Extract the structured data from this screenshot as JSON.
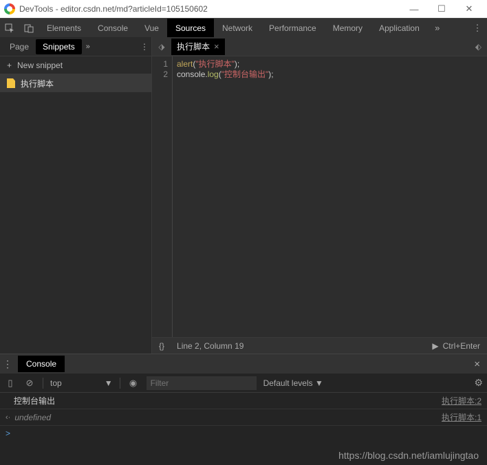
{
  "titlebar": {
    "text": "DevTools - editor.csdn.net/md?articleId=105150602"
  },
  "toolbar": {
    "tabs": [
      "Elements",
      "Console",
      "Vue",
      "Sources",
      "Network",
      "Performance",
      "Memory",
      "Application"
    ],
    "active_index": 3
  },
  "left": {
    "tabs": {
      "page": "Page",
      "snippets": "Snippets"
    },
    "new_snippet": "New snippet",
    "snippet_name": "执行脚本"
  },
  "editor": {
    "tab_name": "执行脚本",
    "lines": [
      {
        "n": "1",
        "fn": "alert",
        "str": "\"执行脚本\"",
        "tail": ");"
      },
      {
        "n": "2",
        "pre": "console.",
        "call": "log",
        "str": "\"控制台输出\"",
        "tail": ");"
      }
    ],
    "status_braces": "{}",
    "status_pos": "Line 2, Column 19",
    "run_label": "Ctrl+Enter"
  },
  "console": {
    "tab": "Console",
    "context": "top",
    "filter_placeholder": "Filter",
    "levels": "Default levels",
    "log_msg": "控制台输出",
    "log_src": "执行脚本:2",
    "ret_val": "undefined",
    "ret_src": "执行脚本:1",
    "prompt": ">"
  },
  "watermark": "https://blog.csdn.net/iamlujingtao"
}
